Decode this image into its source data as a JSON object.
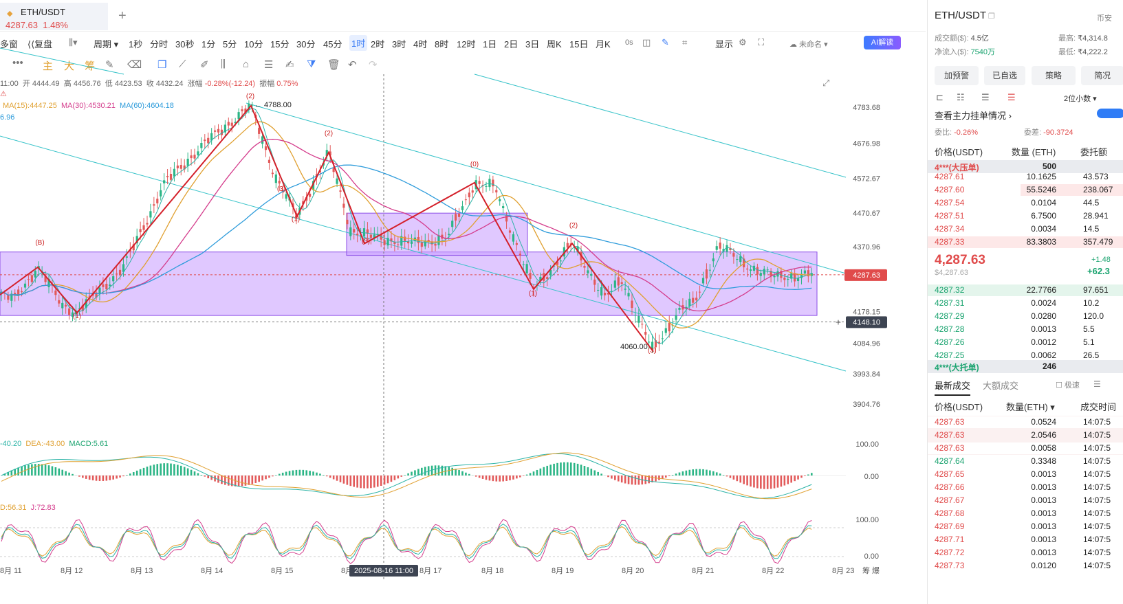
{
  "tab": {
    "symbol": "ETH/USDT",
    "price": "4287.63",
    "change": "1.48%",
    "add": "+"
  },
  "toolbar": {
    "items": [
      "多窗",
      "复盘",
      "",
      "周期",
      "1秒",
      "分时",
      "30秒",
      "1分",
      "5分",
      "10分",
      "15分",
      "30分",
      "45分",
      "1时",
      "2时",
      "3时",
      "4时",
      "8时",
      "12时",
      "1日",
      "2日",
      "3日",
      "周K",
      "15日",
      "月K",
      "0s",
      "",
      "",
      "",
      "显示",
      "",
      "",
      "未命名"
    ],
    "active": "1时",
    "ai": "AI解读"
  },
  "toolbar2": {
    "indicators": [
      "主",
      "大",
      "筹"
    ]
  },
  "ohlc": {
    "time": "11:00",
    "open_label": "开",
    "open": "4444.49",
    "high_label": "高",
    "high": "4456.76",
    "low_label": "低",
    "low": "4423.53",
    "close_label": "收",
    "close": "4432.24",
    "chg_label": "涨幅",
    "chg": "-0.28%(-12.24)",
    "amp_label": "振幅",
    "amp": "0.75%"
  },
  "ma": {
    "flag": "⚠",
    "ma15": "MA(15):4447.25",
    "ma30": "MA(30):4530.21",
    "ma60": "MA(60):4604.18",
    "extra": "6.96"
  },
  "macd": {
    "dif": "-40.20",
    "dea": "DEA:-43.00",
    "macd": "MACD:5.61"
  },
  "kdj": {
    "d": "D:56.31",
    "j": "J:72.83"
  },
  "chart_data": {
    "type": "candlestick",
    "y_ticks": [
      "4783.68",
      "4676.98",
      "4572.67",
      "4470.67",
      "4370.96",
      "4178.15",
      "4084.96",
      "3993.84",
      "3904.76"
    ],
    "macd_ticks": [
      "100.00",
      "0.00"
    ],
    "kdj_ticks": [
      "100.00",
      "0.00"
    ],
    "x_ticks": [
      "8月 11",
      "8月 12",
      "8月 13",
      "8月 14",
      "8月 15",
      "8月",
      "8月 17",
      "8月 18",
      "8月 19",
      "8月 20",
      "8月 21",
      "8月 22",
      "8月 23"
    ],
    "current_price": "4287.63",
    "cursor_price": "4148.10",
    "cursor_time": "2025-08-16 11:00",
    "annotations": {
      "high": "4788.00",
      "low": "4060.00",
      "waves": [
        "(B)",
        "(1)",
        "(2)",
        "(3)",
        "(1)",
        "(2)",
        "(3)",
        "(0)",
        "(1)",
        "(2)",
        "(3)"
      ]
    },
    "price_range": [
      3904.76,
      4783.68
    ],
    "zones": [
      {
        "from": 4167,
        "to": 4355,
        "color": "#c79bff"
      },
      {
        "from": 4345,
        "to": 4470,
        "color": "#c79bff"
      }
    ],
    "channel_color": "#37c3c9"
  },
  "axis_extra": {
    "unit_label": "筹 爆"
  },
  "panel": {
    "symbol": "ETH/USDT",
    "exchange": "币安",
    "volume_label": "成交额($):",
    "volume": "4.5亿",
    "inflow_label": "净流入($):",
    "inflow": "7540万",
    "high_label": "最高:",
    "high": "₹4,314.8",
    "low_label": "最低:",
    "low": "₹4,222.2",
    "buttons": [
      "加预警",
      "已自选",
      "策略",
      "简况"
    ],
    "decimals": "2位小数",
    "main_orders": "查看主力挂单情况",
    "ratio_label": "委比:",
    "ratio": "-0.26%",
    "diff_label": "委差:",
    "diff": "-90.3724",
    "ob_headers": [
      "价格(USDT)",
      "数量 (ETH)",
      "委托额"
    ],
    "big_ask_label": "4***(大压单)",
    "big_ask_qty": "500",
    "asks": [
      {
        "price": "4287.61",
        "qty": "10.1625",
        "total": "43.573"
      },
      {
        "price": "4287.60",
        "qty": "55.5246",
        "total": "238.067"
      },
      {
        "price": "4287.54",
        "qty": "0.0104",
        "total": "44.5"
      },
      {
        "price": "4287.51",
        "qty": "6.7500",
        "total": "28.941"
      },
      {
        "price": "4287.34",
        "qty": "0.0034",
        "total": "14.5"
      },
      {
        "price": "4287.33",
        "qty": "83.3803",
        "total": "357.479"
      }
    ],
    "last_price": "4,287.63",
    "last_usd": "$4,287.63",
    "last_pct": "+1.48",
    "last_abs": "+62.3",
    "bids": [
      {
        "price": "4287.32",
        "qty": "22.7766",
        "total": "97.651"
      },
      {
        "price": "4287.31",
        "qty": "0.0024",
        "total": "10.2"
      },
      {
        "price": "4287.29",
        "qty": "0.0280",
        "total": "120.0"
      },
      {
        "price": "4287.28",
        "qty": "0.0013",
        "total": "5.5"
      },
      {
        "price": "4287.26",
        "qty": "0.0012",
        "total": "5.1"
      },
      {
        "price": "4287.25",
        "qty": "0.0062",
        "total": "26.5"
      }
    ],
    "big_bid_label": "4***(大托单)",
    "big_bid_qty": "246",
    "trades_tabs": [
      "最新成交",
      "大额成交"
    ],
    "fast_label": "极速",
    "trade_headers": [
      "价格(USDT)",
      "数量(ETH)",
      "成交时间"
    ],
    "trades": [
      {
        "price": "4287.63",
        "qty": "0.0524",
        "time": "14:07:5"
      },
      {
        "price": "4287.63",
        "qty": "2.0546",
        "time": "14:07:5"
      },
      {
        "price": "4287.63",
        "qty": "0.0058",
        "time": "14:07:5"
      },
      {
        "price": "4287.64",
        "qty": "0.3348",
        "time": "14:07:5"
      },
      {
        "price": "4287.65",
        "qty": "0.0013",
        "time": "14:07:5"
      },
      {
        "price": "4287.66",
        "qty": "0.0013",
        "time": "14:07:5"
      },
      {
        "price": "4287.67",
        "qty": "0.0013",
        "time": "14:07:5"
      },
      {
        "price": "4287.68",
        "qty": "0.0013",
        "time": "14:07:5"
      },
      {
        "price": "4287.69",
        "qty": "0.0013",
        "time": "14:07:5"
      },
      {
        "price": "4287.71",
        "qty": "0.0013",
        "time": "14:07:5"
      },
      {
        "price": "4287.72",
        "qty": "0.0013",
        "time": "14:07:5"
      },
      {
        "price": "4287.73",
        "qty": "0.0120",
        "time": "14:07:5"
      }
    ]
  }
}
